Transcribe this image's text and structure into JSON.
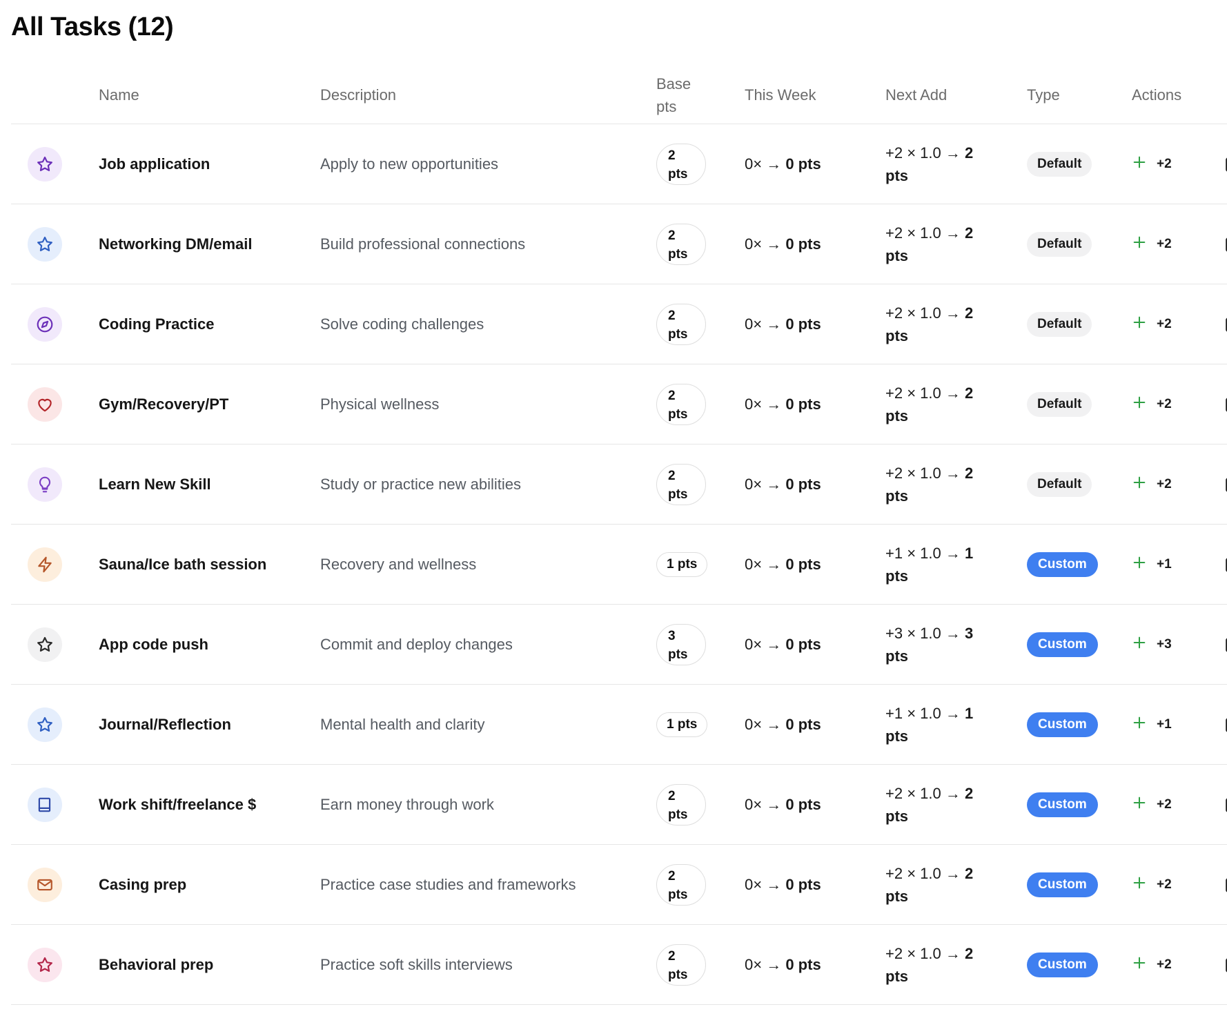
{
  "page": {
    "title": "All Tasks (12)"
  },
  "table": {
    "headers": {
      "name": "Name",
      "description": "Description",
      "base": "Base pts",
      "this_week": "This Week",
      "next_add": "Next Add",
      "type": "Type",
      "actions": "Actions"
    },
    "rows": [
      {
        "icon": "star-icon",
        "icon_bg": "#f1e9fb",
        "icon_color": "#6b2fb8",
        "name": "Job application",
        "description": "Apply to new opportunities",
        "base_num": "2",
        "base_unit": "pts",
        "week_prefix": "0× →",
        "week_value": "0 pts",
        "next_prefix": "+2 × 1.0 →",
        "next_value": "2",
        "next_unit": "pts",
        "type": "Default",
        "action_label": "+2"
      },
      {
        "icon": "star-icon",
        "icon_bg": "#e5eefc",
        "icon_color": "#2f5fc2",
        "name": "Networking DM/email",
        "description": "Build professional connections",
        "base_num": "2",
        "base_unit": "pts",
        "week_prefix": "0× →",
        "week_value": "0 pts",
        "next_prefix": "+2 × 1.0 →",
        "next_value": "2",
        "next_unit": "pts",
        "type": "Default",
        "action_label": "+2"
      },
      {
        "icon": "compass-icon",
        "icon_bg": "#f1e9fb",
        "icon_color": "#6b2fb8",
        "name": "Coding Practice",
        "description": "Solve coding challenges",
        "base_num": "2",
        "base_unit": "pts",
        "week_prefix": "0× →",
        "week_value": "0 pts",
        "next_prefix": "+2 × 1.0 →",
        "next_value": "2",
        "next_unit": "pts",
        "type": "Default",
        "action_label": "+2"
      },
      {
        "icon": "heart-icon",
        "icon_bg": "#fbe6e6",
        "icon_color": "#b3262a",
        "name": "Gym/Recovery/PT",
        "description": "Physical wellness",
        "base_num": "2",
        "base_unit": "pts",
        "week_prefix": "0× →",
        "week_value": "0 pts",
        "next_prefix": "+2 × 1.0 →",
        "next_value": "2",
        "next_unit": "pts",
        "type": "Default",
        "action_label": "+2"
      },
      {
        "icon": "lightbulb-icon",
        "icon_bg": "#f1e9fb",
        "icon_color": "#7a3cc4",
        "name": "Learn New Skill",
        "description": "Study or practice new abilities",
        "base_num": "2",
        "base_unit": "pts",
        "week_prefix": "0× →",
        "week_value": "0 pts",
        "next_prefix": "+2 × 1.0 →",
        "next_value": "2",
        "next_unit": "pts",
        "type": "Default",
        "action_label": "+2"
      },
      {
        "icon": "lightning-icon",
        "icon_bg": "#fdeedd",
        "icon_color": "#b5562a",
        "name": "Sauna/Ice bath session",
        "description": "Recovery and wellness",
        "base_num": "1 pts",
        "base_unit": "",
        "week_prefix": "0× →",
        "week_value": "0 pts",
        "next_prefix": "+1 × 1.0 →",
        "next_value": "1",
        "next_unit": "pts",
        "type": "Custom",
        "action_label": "+1"
      },
      {
        "icon": "star-icon",
        "icon_bg": "#f1f1f2",
        "icon_color": "#2a2a2a",
        "name": "App code push",
        "description": "Commit and deploy changes",
        "base_num": "3",
        "base_unit": "pts",
        "week_prefix": "0× →",
        "week_value": "0 pts",
        "next_prefix": "+3 × 1.0 →",
        "next_value": "3",
        "next_unit": "pts",
        "type": "Custom",
        "action_label": "+3"
      },
      {
        "icon": "star-icon",
        "icon_bg": "#e5eefc",
        "icon_color": "#2f5fc2",
        "name": "Journal/Reflection",
        "description": "Mental health and clarity",
        "base_num": "1 pts",
        "base_unit": "",
        "week_prefix": "0× →",
        "week_value": "0 pts",
        "next_prefix": "+1 × 1.0 →",
        "next_value": "1",
        "next_unit": "pts",
        "type": "Custom",
        "action_label": "+1"
      },
      {
        "icon": "book-icon",
        "icon_bg": "#e5eefc",
        "icon_color": "#2f4aa8",
        "name": "Work shift/freelance $",
        "description": "Earn money through work",
        "base_num": "2",
        "base_unit": "pts",
        "week_prefix": "0× →",
        "week_value": "0 pts",
        "next_prefix": "+2 × 1.0 →",
        "next_value": "2",
        "next_unit": "pts",
        "type": "Custom",
        "action_label": "+2"
      },
      {
        "icon": "mail-icon",
        "icon_bg": "#fdeedd",
        "icon_color": "#b5562a",
        "name": "Casing prep",
        "description": "Practice case studies and frameworks",
        "base_num": "2",
        "base_unit": "pts",
        "week_prefix": "0× →",
        "week_value": "0 pts",
        "next_prefix": "+2 × 1.0 →",
        "next_value": "2",
        "next_unit": "pts",
        "type": "Custom",
        "action_label": "+2"
      },
      {
        "icon": "star-icon",
        "icon_bg": "#fbe6ee",
        "icon_color": "#b3264a",
        "name": "Behavioral prep",
        "description": "Practice soft skills interviews",
        "base_num": "2",
        "base_unit": "pts",
        "week_prefix": "0× →",
        "week_value": "0 pts",
        "next_prefix": "+2 × 1.0 →",
        "next_value": "2",
        "next_unit": "pts",
        "type": "Custom",
        "action_label": "+2"
      }
    ]
  }
}
